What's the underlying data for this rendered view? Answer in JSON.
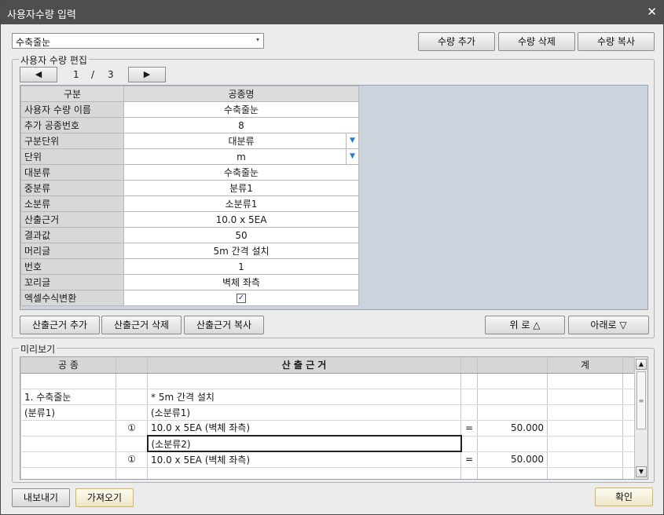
{
  "window": {
    "title": "사용자수량 입력",
    "close": "✕"
  },
  "selector": {
    "value": "수축줄눈",
    "arrow": "▾"
  },
  "top_buttons": {
    "add": "수량 추가",
    "delete": "수량 삭제",
    "copy": "수량 복사"
  },
  "editor": {
    "legend": "사용자 수량 편집",
    "pager": {
      "prev": "◀",
      "current": "1",
      "sep": "/",
      "total": "3",
      "next": "▶"
    },
    "header": {
      "col1": "구분",
      "col2": "공종명"
    },
    "rows": [
      {
        "label": "사용자 수량 이름",
        "value": "수축줄눈"
      },
      {
        "label": "추가 공종번호",
        "value": "8"
      },
      {
        "label": "구분단위",
        "value": "대분류"
      },
      {
        "label": "단위",
        "value": "m"
      },
      {
        "label": "대분류",
        "value": "수축줄눈"
      },
      {
        "label": "중분류",
        "value": "분류1"
      },
      {
        "label": "소분류",
        "value": "소분류1"
      },
      {
        "label": "산출근거",
        "value": "10.0 x 5EA"
      },
      {
        "label": "결과값",
        "value": "50"
      },
      {
        "label": "머리글",
        "value": "5m 간격 설치"
      },
      {
        "label": "번호",
        "value": "1"
      },
      {
        "label": "꼬리글",
        "value": "벽체 좌측"
      },
      {
        "label": "엑셀수식변환",
        "value": ""
      }
    ],
    "excel_checked": true,
    "dropdown_glyph": "▼",
    "check_glyph": "✓",
    "buttons": {
      "add": "산출근거 추가",
      "delete": "산출근거 삭제",
      "copy": "산출근거 복사",
      "up": "위 로 △",
      "down": "아래로 ▽"
    }
  },
  "preview": {
    "legend": "미리보기",
    "headers": {
      "work": "공  종",
      "basis": "산   출   근   거",
      "sum": "계"
    },
    "rows": [
      {
        "work": "",
        "num": "",
        "basis": "",
        "eq": "",
        "result": ""
      },
      {
        "work": "1. 수축줄눈",
        "num": "",
        "basis": "* 5m 간격 설치",
        "eq": "",
        "result": ""
      },
      {
        "work": "(분류1)",
        "num": "",
        "basis": "(소분류1)",
        "eq": "",
        "result": ""
      },
      {
        "work": "",
        "num": "①",
        "basis": "10.0 x 5EA (벽체 좌측)",
        "eq": "=",
        "result": "50.000"
      },
      {
        "work": "",
        "num": "",
        "basis": "(소분류2)",
        "eq": "",
        "result": ""
      },
      {
        "work": "",
        "num": "①",
        "basis": "10.0 x 5EA (벽체 좌측)",
        "eq": "=",
        "result": "50.000"
      },
      {
        "work": "",
        "num": "",
        "basis": "",
        "eq": "",
        "result": ""
      }
    ],
    "scroll": {
      "up": "▲",
      "down": "▼",
      "grip": "≡"
    }
  },
  "bottom_buttons": {
    "export": "내보내기",
    "import": "가져오기",
    "ok": "확인"
  }
}
